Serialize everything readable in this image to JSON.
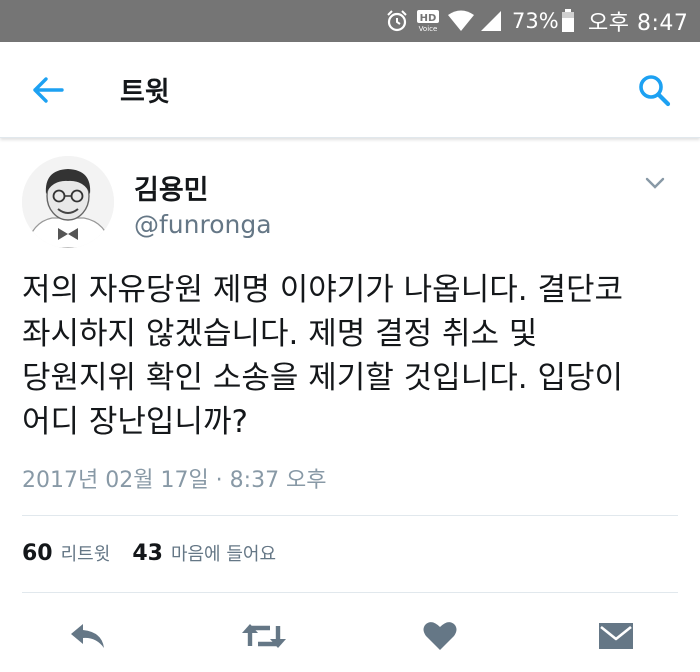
{
  "status_bar": {
    "hd_label": "HD",
    "voice_label": "Voice",
    "battery": "73%",
    "time": "오후 8:47",
    "icons": [
      "alarm-icon",
      "hd-voice-icon",
      "wifi-icon",
      "signal-icon",
      "battery-icon"
    ]
  },
  "app_bar": {
    "title": "트윗",
    "icons": [
      "back-arrow-icon",
      "search-icon"
    ]
  },
  "tweet": {
    "author": {
      "name": "김용민",
      "handle": "@funronga"
    },
    "text_lines": [
      "저의 자유당원 제명 이야기가 나옵니다. 결단코",
      "좌시하지 않겠습니다. 제명 결정 취소 및",
      "당원지위 확인 소송을 제기할 것입니다. 입당이",
      "어디 장난입니까?"
    ],
    "timestamp": "2017년 02월 17일 · 8:37 오후",
    "stats": {
      "retweets_count": "60",
      "retweets_label": "리트윗",
      "likes_count": "43",
      "likes_label": "마음에 들어요"
    },
    "actions": [
      "reply-icon",
      "retweet-icon",
      "heart-icon",
      "direct-message-icon"
    ]
  },
  "colors": {
    "accent": "#1da1f2",
    "status_bar": "#757575",
    "secondary_text": "#657786",
    "action_icon": "#657786"
  }
}
